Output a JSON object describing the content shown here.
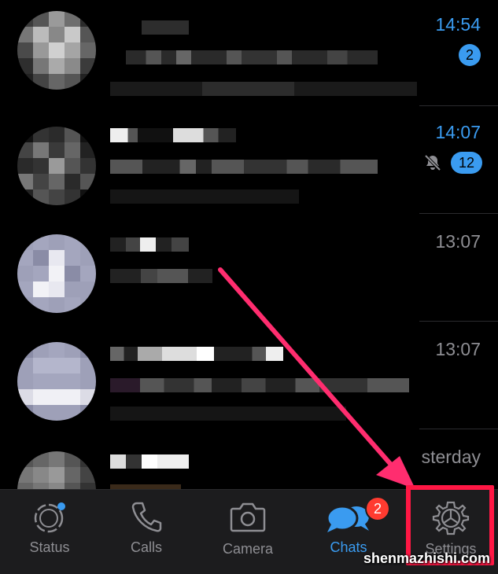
{
  "chats": [
    {
      "time": "14:54",
      "unread": true,
      "badge": "2",
      "muted": false
    },
    {
      "time": "14:07",
      "unread": true,
      "badge": "12",
      "muted": true
    },
    {
      "time": "13:07",
      "unread": false,
      "badge": null,
      "muted": false
    },
    {
      "time": "13:07",
      "unread": false,
      "badge": null,
      "muted": false
    },
    {
      "time": "sterday",
      "unread": false,
      "badge": null,
      "muted": false
    }
  ],
  "tabs": [
    {
      "label": "Status",
      "icon": "status-ring-icon"
    },
    {
      "label": "Calls",
      "icon": "phone-icon"
    },
    {
      "label": "Camera",
      "icon": "camera-icon"
    },
    {
      "label": "Chats",
      "icon": "chat-bubbles-icon",
      "badge": "2",
      "active": true
    },
    {
      "label": "Settings",
      "icon": "gear-icon"
    }
  ],
  "annotation": {
    "highlight_color": "#ff1744",
    "arrow_color": "#ff2d6f"
  },
  "watermark": "shenmazhishi.com",
  "colors": {
    "accent": "#3a9bf0",
    "badge_red": "#ff3b30",
    "tabbar_bg": "#1c1c1e",
    "muted_text": "#8e8e93"
  }
}
